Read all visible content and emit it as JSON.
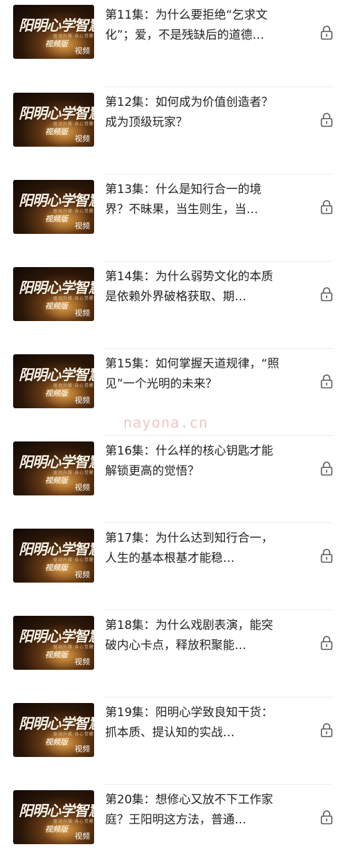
{
  "thumbnail": {
    "title": "阳明心学智慧",
    "subtitle": "驱动升维·自心觉醒",
    "edition": "视频版",
    "badge": "视频"
  },
  "episodes": [
    {
      "title": "第11集：为什么要拒绝“乞求文化”；爱，不是残缺后的道德…",
      "locked": true
    },
    {
      "title": "第12集：如何成为价值创造者？成为顶级玩家？",
      "locked": true
    },
    {
      "title": "第13集：什么是知行合一的境界？不昧果，当生则生，当…",
      "locked": true
    },
    {
      "title": "第14集：为什么弱势文化的本质是依赖外界破格获取、期…",
      "locked": true
    },
    {
      "title": "第15集：如何掌握天道规律，“照见”一个光明的未来？",
      "locked": true
    },
    {
      "title": "第16集：什么样的核心钥匙才能解锁更高的觉悟？",
      "locked": true
    },
    {
      "title": "第17集：为什么达到知行合一，人生的基本根基才能稳…",
      "locked": true
    },
    {
      "title": "第18集：为什么戏剧表演，能突破内心卡点，释放积聚能…",
      "locked": true
    },
    {
      "title": "第19集：阳明心学致良知干货：抓本质、提认知的实战…",
      "locked": true
    },
    {
      "title": "第20集：想修心又放不下工作家庭？王阳明这方法，普通…",
      "locked": true
    }
  ],
  "watermark": "nayona.cn",
  "colors": {
    "text": "#222222",
    "lock": "#555555",
    "divider": "#ececec",
    "watermark": "#e69696"
  },
  "icons": {
    "lock": "lock-icon"
  }
}
